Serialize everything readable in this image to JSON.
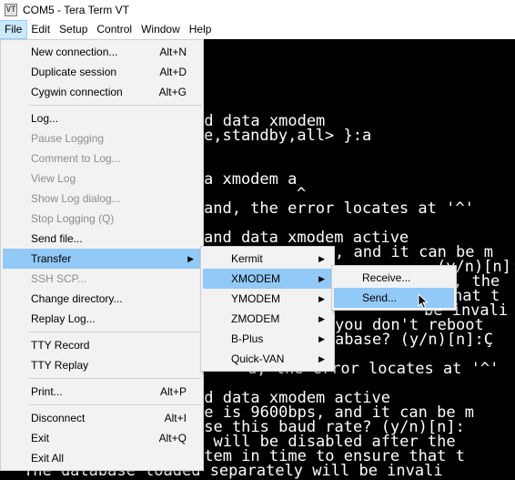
{
  "window": {
    "title": "COM5 - Tera Term VT",
    "icon": "VT"
  },
  "menubar": [
    {
      "label": "File"
    },
    {
      "label": "Edit"
    },
    {
      "label": "Setup"
    },
    {
      "label": "Control"
    },
    {
      "label": "Window"
    },
    {
      "label": "Help"
    }
  ],
  "terminal_lines": [
    "ad data xmodem",
    "e,standby,all> }:a",
    "a xmodem a",
    "^",
    "and, the error locates at '^'",
    "and data xmodem active",
    ", and it can be m",
    "(y/n)[n]:",
    ", the",
    "hat t",
    "be invali",
    "you don't reboot",
    "abase? (y/n)[n]:Ç",
    "d, the error locates at '^'",
    "ad data xmodem active",
    "te is 9600bps, and it can be m",
    "use this baud rate? (y/n)[n]:",
    "h will be disabled after the",
    "stem in time to ensure that t",
    "The database loaded separately will be invali"
  ],
  "file_menu": [
    {
      "label": "New connection...",
      "accel": "Alt+N",
      "enabled": true
    },
    {
      "label": "Duplicate session",
      "accel": "Alt+D",
      "enabled": true
    },
    {
      "label": "Cygwin connection",
      "accel": "Alt+G",
      "enabled": true
    },
    {
      "label": "Log...",
      "accel": "",
      "enabled": true
    },
    {
      "label": "Pause Logging",
      "accel": "",
      "enabled": false
    },
    {
      "label": "Comment to Log...",
      "accel": "",
      "enabled": false
    },
    {
      "label": "View Log",
      "accel": "",
      "enabled": false
    },
    {
      "label": "Show Log dialog...",
      "accel": "",
      "enabled": false
    },
    {
      "label": "Stop Logging (Q)",
      "accel": "",
      "enabled": false
    },
    {
      "label": "Send file...",
      "accel": "",
      "enabled": true
    },
    {
      "label": "Transfer",
      "accel": "",
      "enabled": true
    },
    {
      "label": "SSH SCP...",
      "accel": "",
      "enabled": false
    },
    {
      "label": "Change directory...",
      "accel": "",
      "enabled": true
    },
    {
      "label": "Replay Log...",
      "accel": "",
      "enabled": true
    },
    {
      "label": "TTY Record",
      "accel": "",
      "enabled": true
    },
    {
      "label": "TTY Replay",
      "accel": "",
      "enabled": true
    },
    {
      "label": "Print...",
      "accel": "Alt+P",
      "enabled": true
    },
    {
      "label": "Disconnect",
      "accel": "Alt+I",
      "enabled": true
    },
    {
      "label": "Exit",
      "accel": "Alt+Q",
      "enabled": true
    },
    {
      "label": "Exit All",
      "accel": "",
      "enabled": true
    }
  ],
  "transfer_menu": [
    {
      "label": "Kermit"
    },
    {
      "label": "XMODEM"
    },
    {
      "label": "YMODEM"
    },
    {
      "label": "ZMODEM"
    },
    {
      "label": "B-Plus"
    },
    {
      "label": "Quick-VAN"
    }
  ],
  "xmodem_menu": [
    {
      "label": "Receive..."
    },
    {
      "label": "Send..."
    }
  ],
  "colors": {
    "highlight": "#91c9f7",
    "menu_bg": "#f2f2f2",
    "disabled_text": "#8d8d8d"
  },
  "submenu_arrow": "▶"
}
